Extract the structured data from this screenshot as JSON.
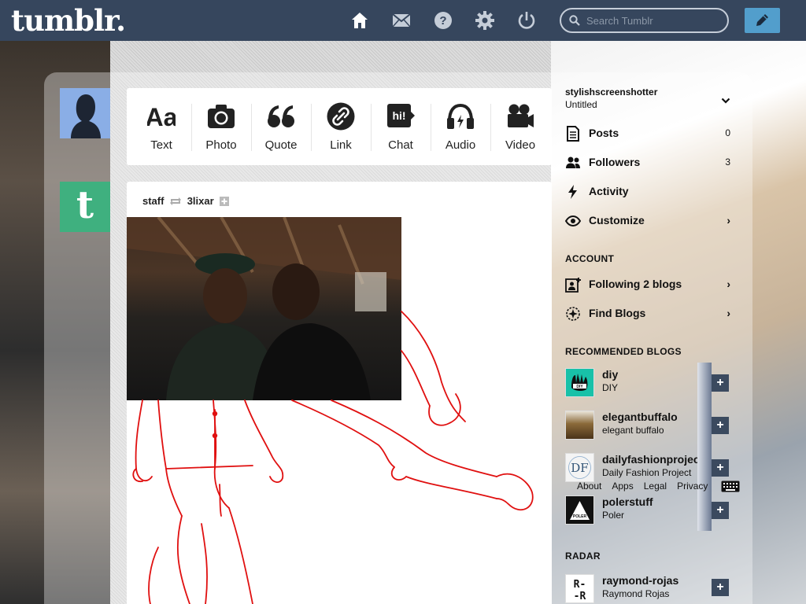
{
  "header": {
    "logo": "tumblr.",
    "search_placeholder": "Search Tumblr",
    "nav_icons": [
      "home-icon",
      "mail-icon",
      "help-icon",
      "gear-icon",
      "power-icon"
    ],
    "compose_icon": "pencil-icon",
    "colors": {
      "bar": "#36465d",
      "compose": "#529ecc"
    }
  },
  "post_types": [
    {
      "label": "Text",
      "icon": "text-icon"
    },
    {
      "label": "Photo",
      "icon": "camera-icon"
    },
    {
      "label": "Quote",
      "icon": "quote-icon"
    },
    {
      "label": "Link",
      "icon": "link-icon"
    },
    {
      "label": "Chat",
      "icon": "chat-icon"
    },
    {
      "label": "Audio",
      "icon": "headphones-icon"
    },
    {
      "label": "Video",
      "icon": "video-camera-icon"
    }
  ],
  "post": {
    "author": "staff",
    "reblogged_from": "3lixar"
  },
  "sidebar": {
    "blog_name": "stylishscreenshotter",
    "blog_title": "Untitled",
    "items": [
      {
        "label": "Posts",
        "count": "0",
        "icon": "document-icon"
      },
      {
        "label": "Followers",
        "count": "3",
        "icon": "people-icon"
      },
      {
        "label": "Activity",
        "count": "",
        "icon": "lightning-icon"
      },
      {
        "label": "Customize",
        "count": "",
        "icon": "eye-icon"
      }
    ],
    "account_header": "ACCOUNT",
    "account_items": [
      {
        "label": "Following 2 blogs",
        "icon": "add-user-icon"
      },
      {
        "label": "Find Blogs",
        "icon": "compass-icon"
      }
    ],
    "recommended_header": "RECOMMENDED BLOGS",
    "recommended": [
      {
        "name": "diy",
        "title": "DIY"
      },
      {
        "name": "elegantbuffalo",
        "title": "elegant buffalo"
      },
      {
        "name": "dailyfashionproject",
        "title": "Daily Fashion Project"
      },
      {
        "name": "polerstuff",
        "title": "Poler"
      }
    ],
    "footer_links": [
      "About",
      "Apps",
      "Legal",
      "Privacy"
    ],
    "radar_header": "RADAR",
    "radar": {
      "name": "raymond-rojas",
      "title": "Raymond Rojas"
    }
  }
}
